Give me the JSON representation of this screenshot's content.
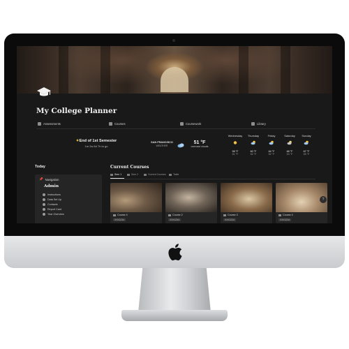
{
  "page": {
    "title": "My College Planner"
  },
  "nav": [
    {
      "label": "Assessments",
      "icon": "assessments-icon"
    },
    {
      "label": "Courses",
      "icon": "courses-icon"
    },
    {
      "label": "Coursework",
      "icon": "coursework-icon"
    },
    {
      "label": "Library",
      "icon": "library-icon"
    }
  ],
  "countdown": {
    "title": "End of 1st Semester",
    "remaining": "1m 2w 6d 7h to go"
  },
  "weather": {
    "location": "SAN FRANCISCO",
    "label": "WEATHER",
    "current_temp": "51 °F",
    "current_condition": "overcast clouds",
    "forecast": [
      {
        "day": "Wednesday",
        "high": "58 °F",
        "low": "51 °F",
        "icon": "sun-icon"
      },
      {
        "day": "Thursday",
        "high": "60 °F",
        "low": "52 °F",
        "icon": "cloud-sun-icon"
      },
      {
        "day": "Friday",
        "high": "64 °F",
        "low": "52 °F",
        "icon": "cloud-sun-icon"
      },
      {
        "day": "Saturday",
        "high": "68 °F",
        "low": "53 °F",
        "icon": "moon-cloud-icon"
      },
      {
        "day": "Sunday",
        "high": "67 °F",
        "low": "55 °F",
        "icon": "cloud-sun-icon"
      }
    ]
  },
  "left": {
    "today_label": "Today",
    "navigation_label": "Navigation",
    "admin_title": "Admin",
    "links": [
      "Instructions",
      "Data Set Up",
      "Contacts",
      "Report Card",
      "Year Overview"
    ]
  },
  "main": {
    "section_title": "Current Courses",
    "tabs": [
      "Sem 1",
      "Sem 2",
      "Current Courses",
      "Table"
    ],
    "courses": [
      {
        "name": "Course 4",
        "code": "XXX1234"
      },
      {
        "name": "Course 2",
        "code": "XXX1234"
      },
      {
        "name": "Course 3",
        "code": "XXX1234"
      },
      {
        "name": "Course 4",
        "code": "XXX1234"
      }
    ]
  },
  "help_label": "?"
}
